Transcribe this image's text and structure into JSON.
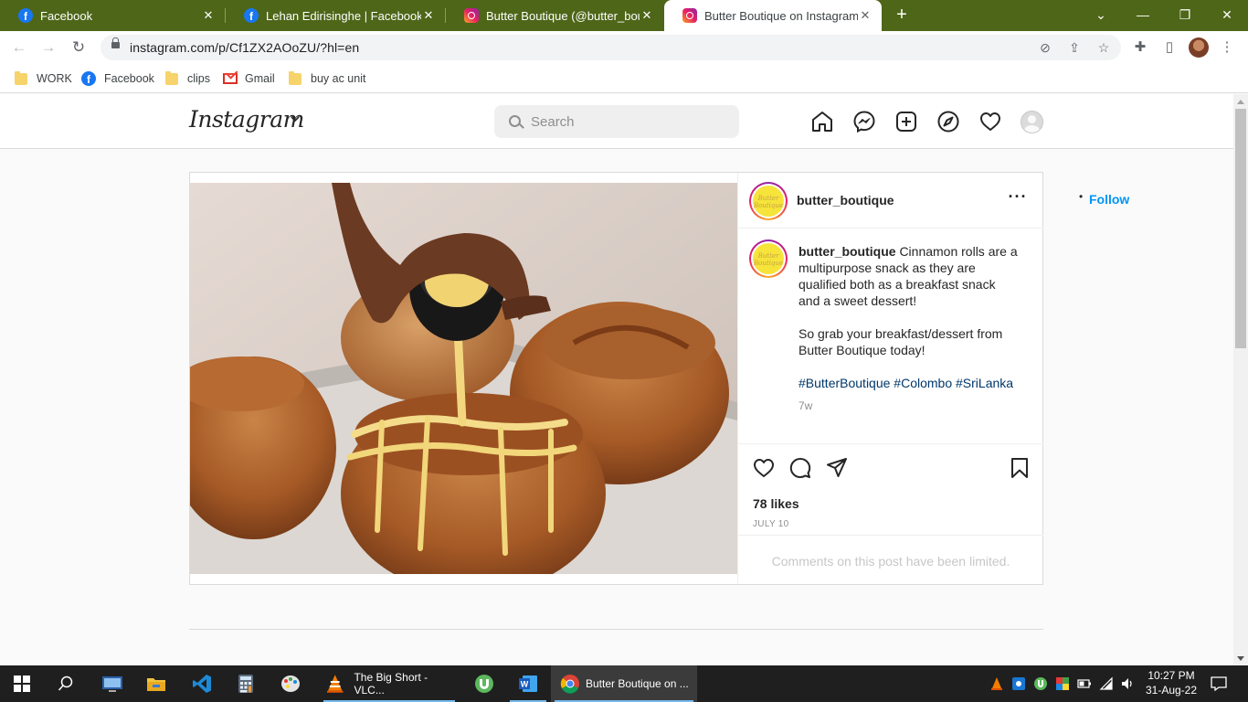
{
  "browser": {
    "tabs": [
      {
        "title": "Facebook",
        "icon": "facebook-icon"
      },
      {
        "title": "Lehan Edirisinghe | Facebook",
        "icon": "facebook-icon"
      },
      {
        "title": "Butter Boutique (@butter_boutiq",
        "icon": "instagram-icon"
      },
      {
        "title": "Butter Boutique on Instagram: \"C",
        "icon": "instagram-icon"
      }
    ],
    "active_tab_index": 3,
    "url": "instagram.com/p/Cf1ZX2AOoZU/?hl=en",
    "bookmarks": [
      {
        "label": "WORK",
        "icon": "folder-icon"
      },
      {
        "label": "Facebook",
        "icon": "facebook-icon"
      },
      {
        "label": "clips",
        "icon": "folder-icon"
      },
      {
        "label": "Gmail",
        "icon": "gmail-icon"
      },
      {
        "label": "buy ac unit",
        "icon": "folder-icon"
      }
    ],
    "theme_color": "#4e6618"
  },
  "instagram": {
    "logo": "Instagram",
    "search_placeholder": "Search",
    "post": {
      "username": "butter_boutique",
      "avatar_text": "Butter Boutique",
      "separator": "•",
      "follow_label": "Follow",
      "caption_paragraphs": [
        "Cinnamon rolls are a multipurpose snack as they are qualified both as a breakfast snack and a sweet dessert!",
        "So grab your breakfast/dessert from Butter Boutique today!"
      ],
      "hashtags": [
        "#ButterBoutique",
        "#Colombo",
        "#SriLanka"
      ],
      "time_ago": "7w",
      "likes": "78 likes",
      "date": "JULY 10",
      "comments_limited": "Comments on this post have been limited.",
      "accent_color": "#0095f6"
    }
  },
  "taskbar": {
    "apps": [
      {
        "name": "file-explorer-app"
      },
      {
        "name": "vscode-app"
      },
      {
        "name": "calculator-app"
      },
      {
        "name": "paint-app"
      },
      {
        "label": "The Big Short - VLC..."
      },
      {
        "name": "utorrent-app"
      },
      {
        "name": "word-app"
      },
      {
        "label": "Butter Boutique on ..."
      }
    ],
    "time": "10:27 PM",
    "date": "31-Aug-22"
  }
}
